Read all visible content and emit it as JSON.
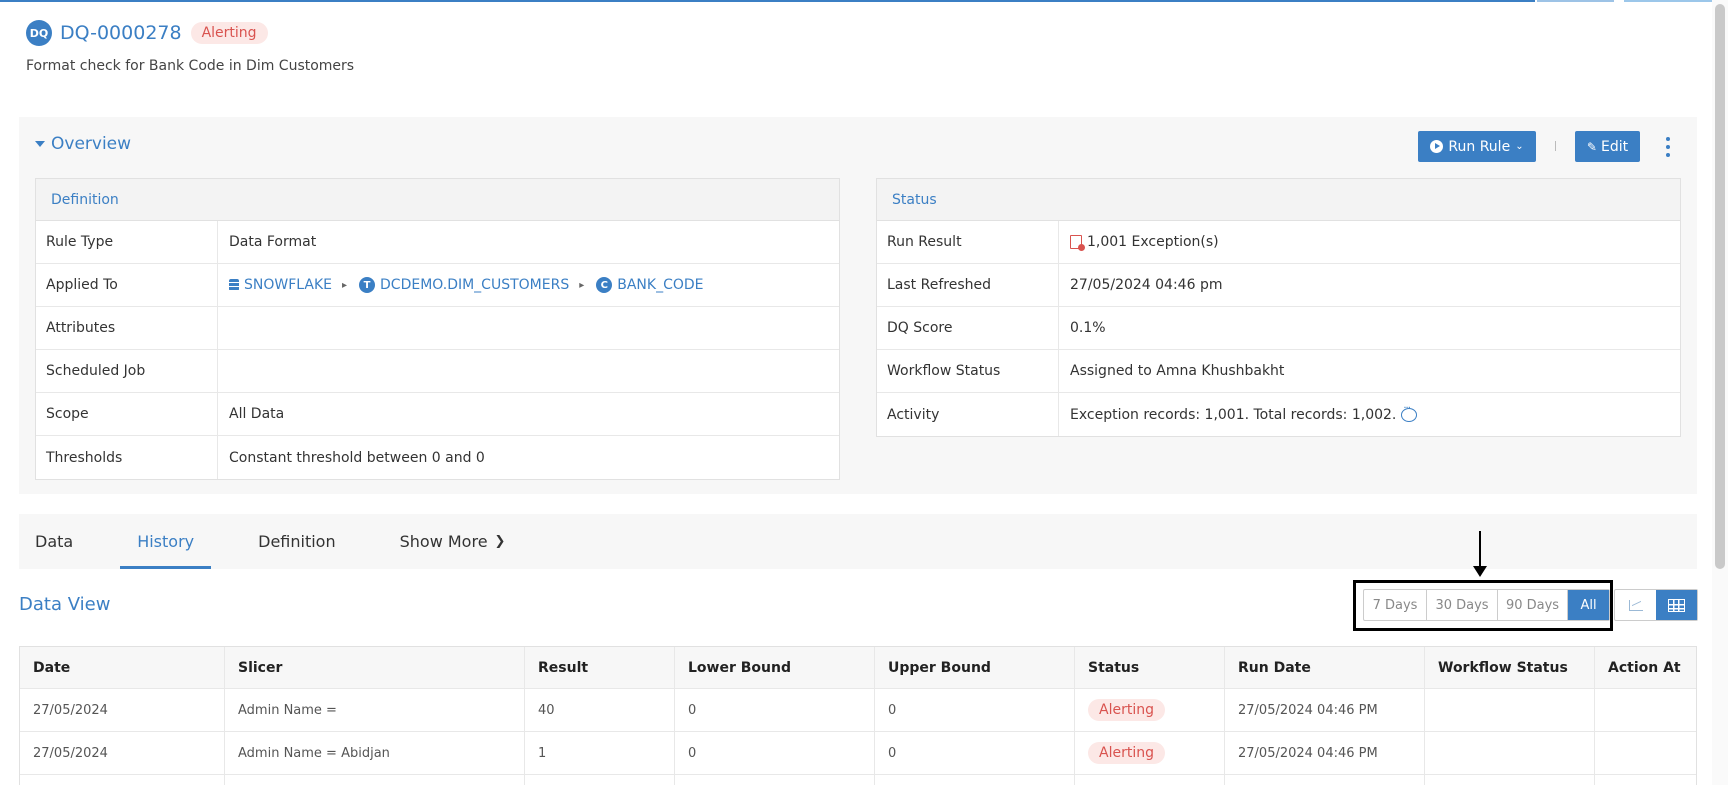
{
  "header": {
    "avatar": "DQ",
    "rule_id": "DQ-0000278",
    "status_badge": "Alerting",
    "description": "Format check for Bank Code in Dim Customers"
  },
  "overview": {
    "title": "Overview",
    "run_rule_label": "Run Rule",
    "edit_label": "Edit",
    "definition": {
      "title": "Definition",
      "rule_type_label": "Rule Type",
      "rule_type": "Data Format",
      "applied_to_label": "Applied To",
      "applied_to": {
        "database": "SNOWFLAKE",
        "table_icon": "T",
        "table": "DCDEMO.DIM_CUSTOMERS",
        "column_icon": "C",
        "column": "BANK_CODE"
      },
      "attributes_label": "Attributes",
      "attributes": "",
      "scheduled_job_label": "Scheduled Job",
      "scheduled_job": "",
      "scope_label": "Scope",
      "scope": "All Data",
      "thresholds_label": "Thresholds",
      "thresholds": "Constant threshold between 0 and 0"
    },
    "status": {
      "title": "Status",
      "run_result_label": "Run Result",
      "run_result": "1,001 Exception(s)",
      "last_refreshed_label": "Last Refreshed",
      "last_refreshed": "27/05/2024 04:46 pm",
      "dq_score_label": "DQ Score",
      "dq_score": "0.1%",
      "workflow_status_label": "Workflow Status",
      "workflow_status": "Assigned to Amna Khushbakht",
      "activity_label": "Activity",
      "activity": "Exception records: 1,001. Total records: 1,002."
    }
  },
  "tabs": [
    {
      "label": "Data"
    },
    {
      "label": "History"
    },
    {
      "label": "Definition"
    },
    {
      "label": "Show More"
    }
  ],
  "data_view": {
    "title": "Data View",
    "ranges": [
      "7 Days",
      "30 Days",
      "90 Days",
      "All"
    ],
    "selected_range": "All",
    "columns": [
      "Date",
      "Slicer",
      "Result",
      "Lower Bound",
      "Upper Bound",
      "Status",
      "Run Date",
      "Workflow Status",
      "Action At"
    ],
    "rows": [
      {
        "date": "27/05/2024",
        "slicer": "Admin Name =",
        "result": "40",
        "lower": "0",
        "upper": "0",
        "status": "Alerting",
        "run_date": "27/05/2024 04:46 PM",
        "workflow": "",
        "action_at": ""
      },
      {
        "date": "27/05/2024",
        "slicer": "Admin Name = Abidjan",
        "result": "1",
        "lower": "0",
        "upper": "0",
        "status": "Alerting",
        "run_date": "27/05/2024 04:46 PM",
        "workflow": "",
        "action_at": ""
      },
      {
        "date": "",
        "slicer": "",
        "result": "",
        "lower": "",
        "upper": "",
        "status": "",
        "run_date": "",
        "workflow": "",
        "action_at": ""
      }
    ]
  },
  "colors": {
    "accent": "#3b7fc4",
    "alert": "#d9534f",
    "alert_bg": "#fce8e6"
  }
}
